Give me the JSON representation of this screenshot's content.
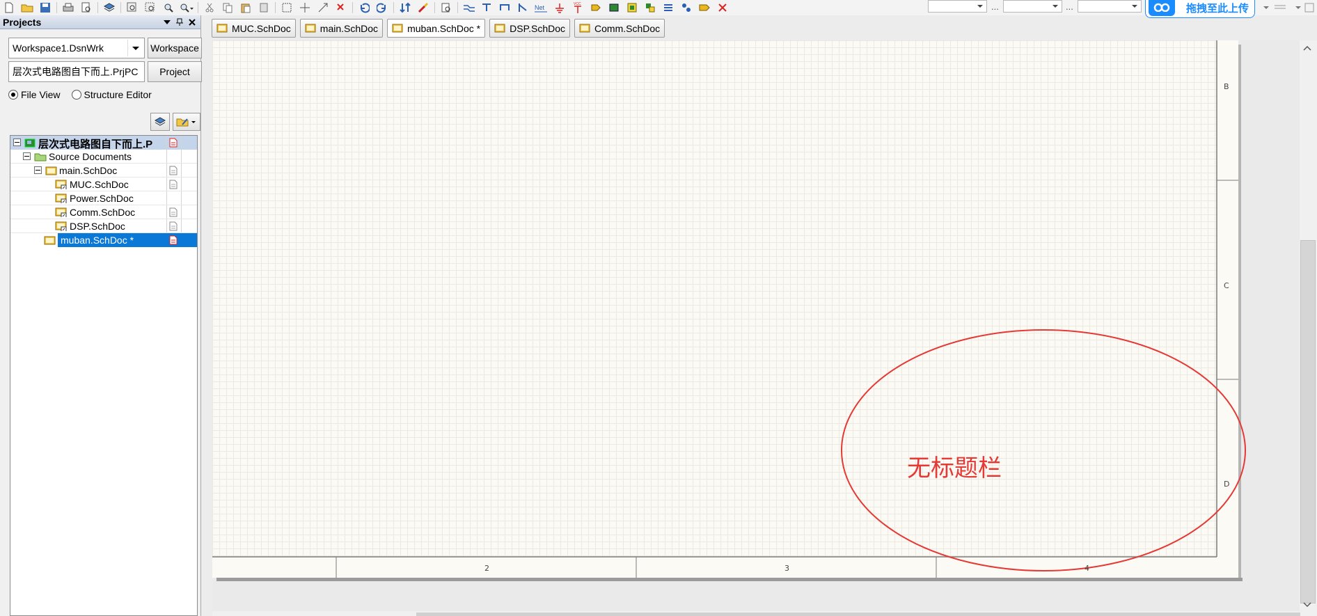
{
  "panel": {
    "title": "Projects",
    "workspace_select": "Workspace1.DsnWrk",
    "workspace_button": "Workspace",
    "project_field": "层次式电路图自下而上.PrjPC",
    "project_button": "Project",
    "view_options": [
      {
        "label": "File View",
        "selected": true
      },
      {
        "label": "Structure Editor",
        "selected": false
      }
    ]
  },
  "tree": {
    "project": "层次式电路图自下而上.P",
    "folder": "Source Documents",
    "items": [
      {
        "label": "main.SchDoc"
      },
      {
        "label": "MUC.SchDoc"
      },
      {
        "label": "Power.SchDoc"
      },
      {
        "label": "Comm.SchDoc"
      },
      {
        "label": "DSP.SchDoc"
      },
      {
        "label": "muban.SchDoc *"
      }
    ]
  },
  "tabs": [
    {
      "label": "MUC.SchDoc"
    },
    {
      "label": "main.SchDoc"
    },
    {
      "label": "muban.SchDoc *"
    },
    {
      "label": "DSP.SchDoc"
    },
    {
      "label": "Comm.SchDoc"
    }
  ],
  "toolbar": {
    "upload_label": "拖拽至此上传",
    "dots": "..."
  },
  "sheet": {
    "row_labels": [
      "B",
      "C",
      "D"
    ],
    "col_labels": [
      "2",
      "3",
      "4"
    ],
    "annotation": "无标题栏",
    "annotation_color": "#e53935"
  },
  "colors": {
    "selection": "#0a78d7",
    "sheet_bg": "#fcfaf5",
    "upload_blue": "#1a8cff"
  }
}
